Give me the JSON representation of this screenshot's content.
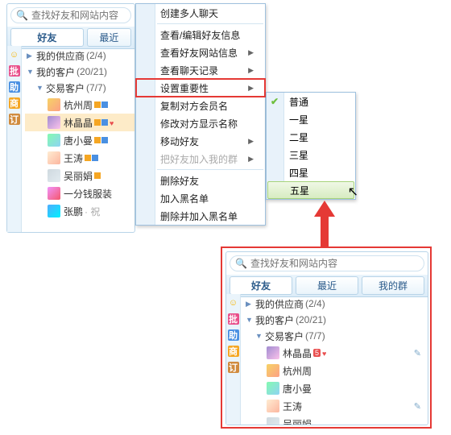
{
  "search": {
    "placeholder": "查找好友和网站内容"
  },
  "tabs": {
    "friends": "好友",
    "recent": "最近",
    "groups": "我的群"
  },
  "tree": {
    "suppliers": {
      "label": "我的供应商",
      "count": "(2/4)"
    },
    "customers": {
      "label": "我的客户",
      "count": "(20/21)"
    },
    "deals": {
      "label": "交易客户",
      "count": "(7/7)"
    }
  },
  "contacts_top": [
    {
      "name": "杭州周",
      "marks": [
        "o",
        "b"
      ]
    },
    {
      "name": "林晶晶",
      "marks": [
        "o",
        "b"
      ],
      "heart": true,
      "selected": true
    },
    {
      "name": "唐小曼",
      "marks": [
        "o",
        "b"
      ]
    },
    {
      "name": "王涛",
      "marks": [
        "o",
        "b"
      ]
    },
    {
      "name": "吴丽娟",
      "marks": [
        "o"
      ]
    },
    {
      "name": "一分钱服装",
      "marks": []
    },
    {
      "name": "张鹏",
      "suffix": "· 祝",
      "gray": true
    }
  ],
  "menu": {
    "create_group_chat": "创建多人聊天",
    "view_edit_info": "查看/编辑好友信息",
    "view_site_info": "查看好友网站信息",
    "view_chat_log": "查看聊天记录",
    "set_importance": "设置重要性",
    "copy_member_name": "复制对方会员名",
    "edit_display_name": "修改对方显示名称",
    "move_friend": "移动好友",
    "add_to_my_group": "把好友加入我的群",
    "delete_friend": "删除好友",
    "add_blacklist": "加入黑名单",
    "delete_add_blacklist": "删除并加入黑名单"
  },
  "submenu": {
    "normal": "普通",
    "one": "一星",
    "two": "二星",
    "three": "三星",
    "four": "四星",
    "five": "五星"
  },
  "bottom_contacts": [
    {
      "name": "林晶晶",
      "star5": "5",
      "heart": true,
      "pencil": true
    },
    {
      "name": "杭州周"
    },
    {
      "name": "唐小曼"
    },
    {
      "name": "王涛",
      "pencil": true
    },
    {
      "name": "吴丽娟"
    }
  ]
}
